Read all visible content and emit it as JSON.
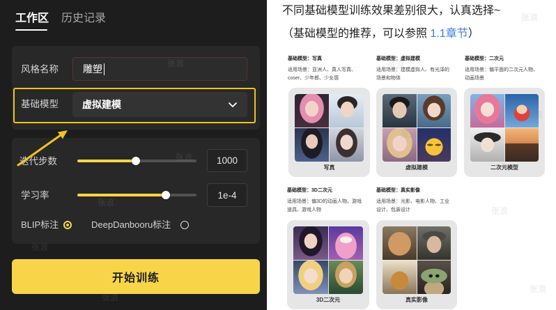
{
  "watermark": "张浪",
  "colors": {
    "panel_bg": "#1d1d1d",
    "card_bg": "#282828",
    "accent_yellow": "#f8d548",
    "highlight_border": "#f2c21f",
    "link_blue": "#3b7ddd"
  },
  "icons": {
    "dropdown": "chevron-down-icon",
    "annotation_arrow": "pointer-arrow-icon",
    "radio_selected": "radio-selected-icon",
    "radio_unselected": "radio-unselected-icon"
  },
  "tabs": [
    {
      "label": "工作区",
      "active": true
    },
    {
      "label": "历史记录",
      "active": false
    }
  ],
  "form": {
    "style_name": {
      "label": "风格名称",
      "value": "雕塑"
    },
    "base_model": {
      "label": "基础模型",
      "selected": "虚拟建模"
    },
    "iterations": {
      "label": "迭代步数",
      "value": "1000",
      "slider_level": 0.49
    },
    "learning_rate": {
      "label": "学习率",
      "value": "1e-4",
      "slider_level": 0.74
    },
    "labeling": [
      {
        "label": "BLIP标注",
        "selected": true
      },
      {
        "label": "DeepDanbooru标注",
        "selected": false
      }
    ]
  },
  "start_button": {
    "label": "开始训练"
  },
  "guide": {
    "line1": "不同基础模型训练效果差别很大，认真选择~",
    "line2_before": "（基础模型的推荐，可以参照 ",
    "line2_link": "1.1章节",
    "line2_after": "）"
  },
  "models": [
    {
      "title": "基础模型：写真",
      "scene": [
        "适用场景：亚洲人、真人写真、",
        "coser、少年郎、少女感"
      ],
      "caption": "写真"
    },
    {
      "title": "基础模型：虚拟建模",
      "scene": [
        "适用场景：建模虚拟人、有光泽的",
        "场景和物体"
      ],
      "caption": "虚拟建模"
    },
    {
      "title": "基础模型：二次元",
      "scene": [
        "适用场景：偏平面的二次元人物、",
        "动画场景"
      ],
      "caption": "二次元模型"
    },
    {
      "title": "基础模型：3D二次元",
      "scene": [
        "适用场景：偏3D的动画人物、游戏",
        "道具、游戏人物"
      ],
      "caption": "3D二次元"
    },
    {
      "title": "基础模型：真实影像",
      "scene": [
        "适用场景：光影、电影人物、工业",
        "设计、包装设计"
      ],
      "caption": "真实影像"
    }
  ]
}
